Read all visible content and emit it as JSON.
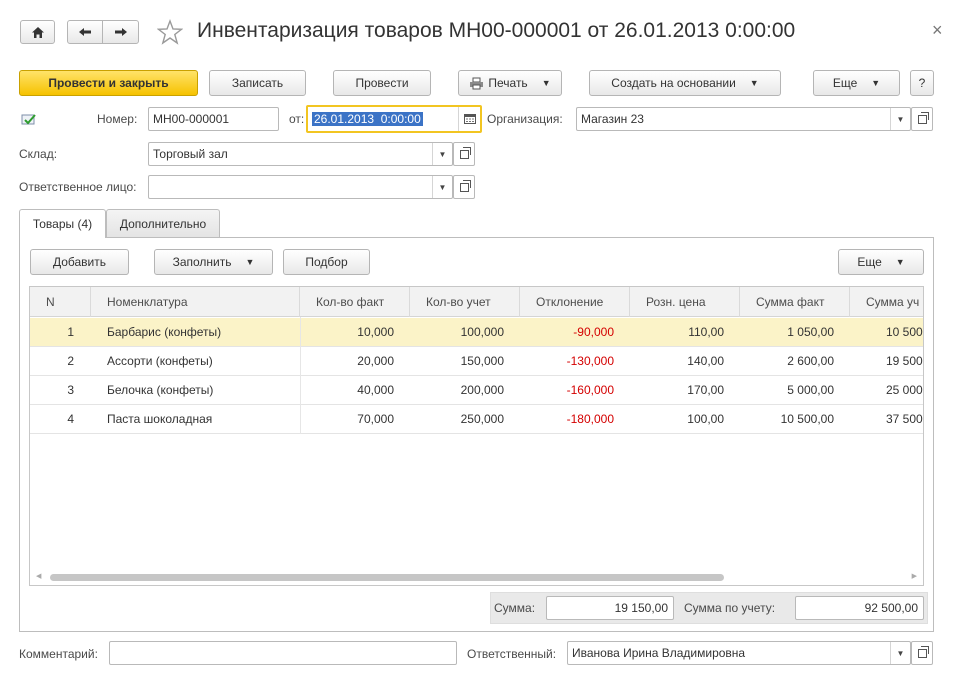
{
  "header": {
    "title": "Инвентаризация товаров МН00-000001 от 26.01.2013 0:00:00",
    "close_glyph": "×"
  },
  "toolbar": {
    "post_close": "Провести и закрыть",
    "save": "Записать",
    "post": "Провести",
    "print": "Печать",
    "create_based": "Создать на основании",
    "more": "Еще",
    "help": "?"
  },
  "form": {
    "number_label": "Номер:",
    "number_value": "МН00-000001",
    "date_label": "от:",
    "date_value": "26.01.2013  0:00:00",
    "org_label": "Организация:",
    "org_value": "Магазин 23",
    "warehouse_label": "Склад:",
    "warehouse_value": "Торговый зал",
    "resp_label": "Ответственное лицо:",
    "resp_value": ""
  },
  "tabs": [
    {
      "label": "Товары (4)"
    },
    {
      "label": "Дополнительно"
    }
  ],
  "table_toolbar": {
    "add": "Добавить",
    "fill": "Заполнить",
    "pick": "Подбор",
    "more": "Еще"
  },
  "table": {
    "columns": [
      "N",
      "Номенклатура",
      "Кол-во факт",
      "Кол-во учет",
      "Отклонение",
      "Розн. цена",
      "Сумма факт",
      "Сумма уч"
    ],
    "rows": [
      {
        "n": "1",
        "name": "Барбарис (конфеты)",
        "fact": "10,000",
        "acc": "100,000",
        "dev": "-90,000",
        "price": "110,00",
        "sum_fact": "1 050,00",
        "sum_acc": "10 500"
      },
      {
        "n": "2",
        "name": "Ассорти (конфеты)",
        "fact": "20,000",
        "acc": "150,000",
        "dev": "-130,000",
        "price": "140,00",
        "sum_fact": "2 600,00",
        "sum_acc": "19 500"
      },
      {
        "n": "3",
        "name": "Белочка (конфеты)",
        "fact": "40,000",
        "acc": "200,000",
        "dev": "-160,000",
        "price": "170,00",
        "sum_fact": "5 000,00",
        "sum_acc": "25 000"
      },
      {
        "n": "4",
        "name": "Паста шоколадная",
        "fact": "70,000",
        "acc": "250,000",
        "dev": "-180,000",
        "price": "100,00",
        "sum_fact": "10 500,00",
        "sum_acc": "37 500"
      }
    ]
  },
  "totals": {
    "sum_label": "Сумма:",
    "sum_value": "19 150,00",
    "sum_acc_label": "Сумма по учету:",
    "sum_acc_value": "92 500,00"
  },
  "footer": {
    "comment_label": "Комментарий:",
    "comment_value": "",
    "responsible_label": "Ответственный:",
    "responsible_value": "Иванова Ирина Владимировна"
  },
  "colors": {
    "accent_yellow": "#f6c200",
    "negative_red": "#d40000",
    "selected_row": "#fbf3c8"
  },
  "icons": [
    "home-icon",
    "back-arrow-icon",
    "forward-arrow-icon",
    "star-icon",
    "printer-icon",
    "calendar-icon",
    "posted-document-icon"
  ]
}
